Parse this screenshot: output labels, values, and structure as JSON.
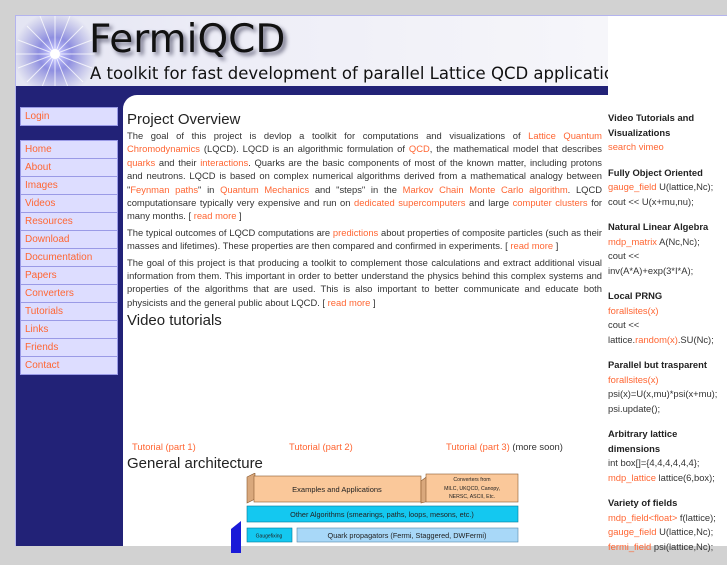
{
  "header": {
    "title": "FermiQCD",
    "tagline": "A toolkit for fast development of parallel Lattice QCD applications"
  },
  "sidebar": {
    "login": "Login",
    "items": [
      {
        "label": "Home"
      },
      {
        "label": "About"
      },
      {
        "label": "Images"
      },
      {
        "label": "Videos"
      },
      {
        "label": "Resources"
      },
      {
        "label": "Download"
      },
      {
        "label": "Documentation"
      },
      {
        "label": "Papers"
      },
      {
        "label": "Converters"
      },
      {
        "label": "Tutorials"
      },
      {
        "label": "Links"
      },
      {
        "label": "Friends"
      },
      {
        "label": "Contact"
      }
    ]
  },
  "main": {
    "overview_title": "Project Overview",
    "p1": {
      "t1": "The goal of this project is devlop a toolkit for computations and visualizations of ",
      "l1": "Lattice Quantum Chromodynamics",
      "t2": " (LQCD). LQCD is an algorithmic formulation of ",
      "l2": "QCD",
      "t3": ", the mathematical model that describes ",
      "l3": "quarks",
      "t4": " and their ",
      "l4": "interactions",
      "t5": ". Quarks are the basic components of most of the known matter, including protons and neutrons. LQCD is based on complex numerical algorithms derived from a mathematical analogy between \"",
      "l5": "Feynman paths",
      "t6": "\" in ",
      "l6": "Quantum Mechanics",
      "t7": " and \"steps\" in the ",
      "l7": "Markov Chain Monte Carlo algorithm",
      "t8": ". LQCD computationsare typically very expensive and run on ",
      "l8": "dedicated supercomputers",
      "t9": " and large ",
      "l9": "computer clusters",
      "t10": " for many months. [ ",
      "more": "read more",
      "t11": " ]"
    },
    "p2": {
      "t1": "The typical outcomes of LQCD computations are ",
      "l1": "predictions",
      "t2": " about properties of composite particles (such as their masses and lifetimes). These properties are then compared and confirmed in experiments. [ ",
      "more": "read more",
      "t3": " ]"
    },
    "p3": {
      "t1": "The goal of this project is that producing a toolkit to complement those calculations and extract additional visual information from them. This important in order to better understand the physics behind this complex systems and properties of the algorithms that are used. This is also important to better communicate and educate both physicists and the general public about LQCD. [ ",
      "more": "read more",
      "t2": " ]"
    },
    "video_title": "Video tutorials",
    "tutorials": [
      {
        "label": "Tutorial (part 1)"
      },
      {
        "label": "Tutorial (part 2)"
      },
      {
        "label": "Tutorial (part 3)"
      }
    ],
    "more_soon": " (more soon)",
    "arch_title": "General architecture",
    "diagram": {
      "examples": "Examples and Applications",
      "converters": "Converters from MILC, UKQCD, Canopy, NERSC, ASCII, Etc.",
      "other_algorithms": "Other Algorithms (smearings, paths, loops, mesons, etc.)",
      "gaugefixing": "Gaugefixing",
      "quark_propagators": "Quark propagators (Fermi, Staggered, DWFermi)"
    }
  },
  "right": {
    "blocks": [
      {
        "title": "Video Tutorials and Visualizations",
        "lines": [
          {
            "link": "search vimeo",
            "text": ""
          }
        ]
      },
      {
        "title": "Fully Object Oriented",
        "lines": [
          {
            "link": "gauge_field",
            "text": " U(lattice,Nc);"
          },
          {
            "link": "",
            "text": "cout << U(x+mu,nu);"
          }
        ]
      },
      {
        "title": "Natural Linear Algebra",
        "lines": [
          {
            "link": "mdp_matrix",
            "text": " A(Nc,Nc);"
          },
          {
            "link": "",
            "text": "cout <<"
          },
          {
            "link": "",
            "text": "inv(A*A)+exp(3*I*A);"
          }
        ]
      },
      {
        "title": "Local PRNG",
        "lines": [
          {
            "link": "forallsites(x)",
            "text": ""
          },
          {
            "link": "",
            "text": "cout <<"
          },
          {
            "pre": "lattice.",
            "link": "random(x)",
            "text": ".SU(Nc);"
          }
        ]
      },
      {
        "title": "Parallel but trasparent",
        "lines": [
          {
            "link": "forallsites(x)",
            "text": ""
          },
          {
            "link": "",
            "text": "psi(x)=U(x,mu)*psi(x+mu);"
          },
          {
            "link": "",
            "text": "psi.update();"
          }
        ]
      },
      {
        "title": "Arbitrary lattice dimensions",
        "lines": [
          {
            "link": "",
            "text": "int box[]={4,4,4,4,4,4};"
          },
          {
            "link": "mdp_lattice",
            "text": " lattice(6,box);"
          }
        ]
      },
      {
        "title": "Variety of fields",
        "lines": [
          {
            "link": "mdp_field<float>",
            "text": " f(lattice);"
          },
          {
            "link": "gauge_field",
            "text": " U(lattice,Nc);"
          },
          {
            "link": "fermi_field",
            "text": " psi(lattice,Nc);"
          }
        ]
      }
    ]
  }
}
